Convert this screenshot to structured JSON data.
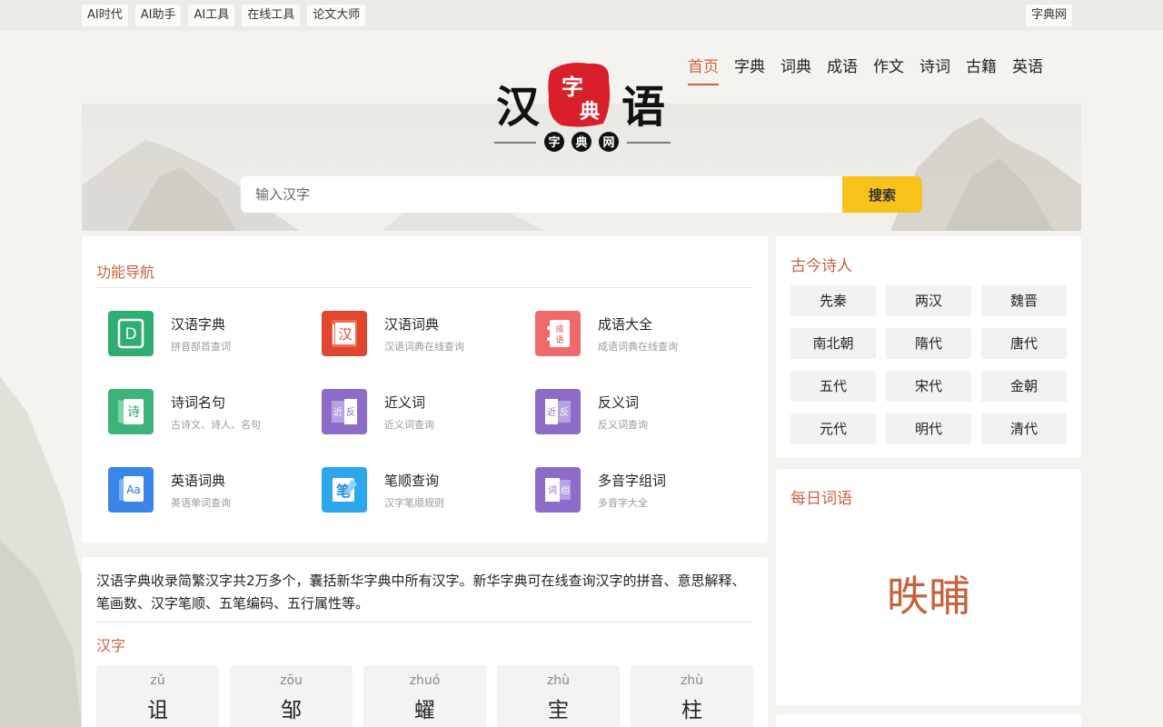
{
  "topbar": {
    "links": [
      "AI时代",
      "AI助手",
      "AI工具",
      "在线工具",
      "论文大师"
    ],
    "right_link": "字典网"
  },
  "logo": {
    "left_char": "汉",
    "right_char": "语",
    "seal_top": "字",
    "seal_bottom": "典",
    "sub": [
      "字",
      "典",
      "网"
    ]
  },
  "nav": [
    "首页",
    "字典",
    "词典",
    "成语",
    "作文",
    "诗词",
    "古籍",
    "英语"
  ],
  "search": {
    "placeholder": "输入汉字",
    "button": "搜索"
  },
  "functions": {
    "title": "功能导航",
    "items": [
      {
        "title": "汉语字典",
        "sub": "拼音部首查词",
        "icon": "dictionary-d-icon",
        "glyph": "D",
        "color": "#2fae72"
      },
      {
        "title": "汉语词典",
        "sub": "汉语词典在线查询",
        "icon": "word-dictionary-icon",
        "glyph": "汉",
        "color": "#e0452e"
      },
      {
        "title": "成语大全",
        "sub": "成语词典在线查询",
        "icon": "idiom-book-icon",
        "glyph": "成语",
        "color": "#ef6b6b"
      },
      {
        "title": "诗词名句",
        "sub": "古诗文、诗人、名句",
        "icon": "poetry-book-icon",
        "glyph": "诗",
        "color": "#3bb37a"
      },
      {
        "title": "近义词",
        "sub": "近义词查询",
        "icon": "synonym-icon",
        "glyph": "近反",
        "color": "#8d6cc9"
      },
      {
        "title": "反义词",
        "sub": "反义词查询",
        "icon": "antonym-icon",
        "glyph": "近反",
        "color": "#8d6cc9"
      },
      {
        "title": "英语词典",
        "sub": "英语单词查询",
        "icon": "english-dictionary-icon",
        "glyph": "Aa",
        "color": "#3a86e8"
      },
      {
        "title": "笔顺查询",
        "sub": "汉字笔顺规则",
        "icon": "stroke-order-icon",
        "glyph": "笔",
        "color": "#2ca6ec"
      },
      {
        "title": "多音字组词",
        "sub": "多音字大全",
        "icon": "polyphone-icon",
        "glyph": "词组",
        "color": "#8d6cc9"
      }
    ]
  },
  "intro": {
    "text": "汉语字典收录简繁汉字共2万多个，囊括新华字典中所有汉字。新华字典可在线查询汉字的拼音、意思解释、笔画数、汉字笔顺、五笔编码、五行属性等。",
    "chars_title": "汉字",
    "chars": [
      {
        "py": "zǔ",
        "hz": "诅"
      },
      {
        "py": "zōu",
        "hz": "邹"
      },
      {
        "py": "zhuó",
        "hz": "蠗"
      },
      {
        "py": "zhù",
        "hz": "宔"
      },
      {
        "py": "zhù",
        "hz": "柱"
      }
    ]
  },
  "poets": {
    "title": "古今诗人",
    "dynasties": [
      "先秦",
      "两汉",
      "魏晋",
      "南北朝",
      "隋代",
      "唐代",
      "五代",
      "宋代",
      "金朝",
      "元代",
      "明代",
      "清代"
    ]
  },
  "daily": {
    "title": "每日词语",
    "word": "昳晡"
  },
  "colors": {
    "accent": "#c8623d",
    "search_button": "#f7c21a"
  }
}
